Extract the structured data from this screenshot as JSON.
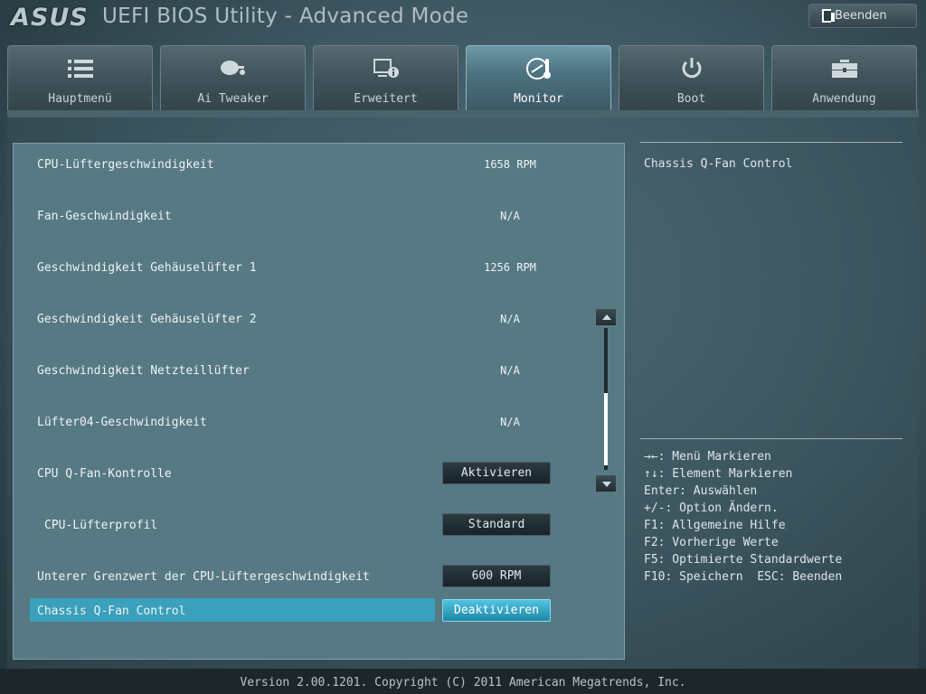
{
  "header": {
    "brand": "ASUS",
    "title": "UEFI BIOS Utility - Advanced Mode",
    "exit_label": "Beenden"
  },
  "tabs": [
    {
      "label": "Hauptmenü",
      "icon": "list-icon"
    },
    {
      "label": "Ai Tweaker",
      "icon": "tweaker-icon"
    },
    {
      "label": "Erweitert",
      "icon": "advanced-icon"
    },
    {
      "label": "Monitor",
      "icon": "thermometer-icon",
      "active": true
    },
    {
      "label": "Boot",
      "icon": "power-icon"
    },
    {
      "label": "Anwendung",
      "icon": "toolbox-icon"
    }
  ],
  "rows": [
    {
      "label": "CPU-Lüftergeschwindigkeit",
      "value": "1658 RPM"
    },
    {
      "label": "Fan-Geschwindigkeit",
      "value": "N/A"
    },
    {
      "label": "Geschwindigkeit Gehäuselüfter 1",
      "value": "1256 RPM"
    },
    {
      "label": "Geschwindigkeit Gehäuselüfter 2",
      "value": "N/A"
    },
    {
      "label": "Geschwindigkeit Netzteillüfter",
      "value": "N/A"
    },
    {
      "label": "Lüfter04-Geschwindigkeit",
      "value": "N/A"
    },
    {
      "label": "CPU Q-Fan-Kontrolle",
      "option": "Aktivieren"
    },
    {
      "label": "CPU-Lüfterprofil",
      "option": "Standard"
    },
    {
      "label": "Unterer Grenzwert der CPU-Lüftergeschwindigkeit",
      "option": "600 RPM"
    },
    {
      "label": "Chassis Q-Fan Control",
      "option": "Deaktivieren",
      "selected": true
    }
  ],
  "help": {
    "title": "Chassis Q-Fan Control",
    "lines": [
      "→←: Menü Markieren",
      "↑↓: Element Markieren",
      "Enter: Auswählen",
      "+/-: Option Ändern.",
      "F1: Allgemeine Hilfe",
      "F2: Vorherige Werte",
      "F5: Optimierte Standardwerte",
      "F10: Speichern  ESC: Beenden"
    ]
  },
  "footer": {
    "text": "Version 2.00.1201. Copyright (C) 2011 American Megatrends, Inc."
  },
  "colors": {
    "accent": "#3aa0bc",
    "panel": "#567983"
  }
}
